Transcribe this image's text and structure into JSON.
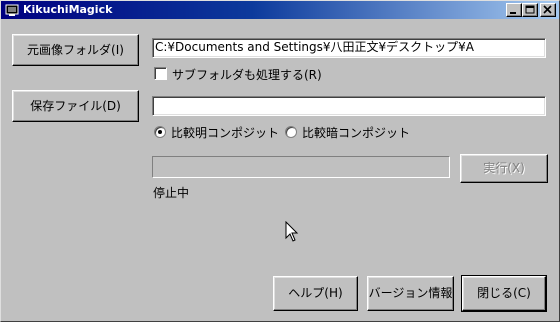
{
  "window": {
    "title": "KikuchiMagick"
  },
  "source": {
    "button_label": "元画像フォルダ(I)",
    "path_value": "C:¥Documents and Settings¥八田正文¥デスクトップ¥A",
    "subfolder_label": "サブフォルダも処理する(R)",
    "subfolder_checked": false
  },
  "output": {
    "button_label": "保存ファイル(D)",
    "path_value": ""
  },
  "mode": {
    "options": [
      {
        "label": "比較明コンポジット",
        "checked": true
      },
      {
        "label": "比較暗コンポジット",
        "checked": false
      }
    ]
  },
  "progress": {
    "fraction": 0,
    "run_label": "実行(X)",
    "status_text": "停止中"
  },
  "footer": {
    "help_label": "ヘルプ(H)",
    "version_label": "バージョン情報",
    "close_label": "閉じる(C)"
  },
  "icons": {
    "app": "app-icon",
    "minimize": "minimize-icon",
    "maximize": "maximize-icon",
    "close": "close-icon",
    "cursor": "mouse-pointer-icon"
  }
}
